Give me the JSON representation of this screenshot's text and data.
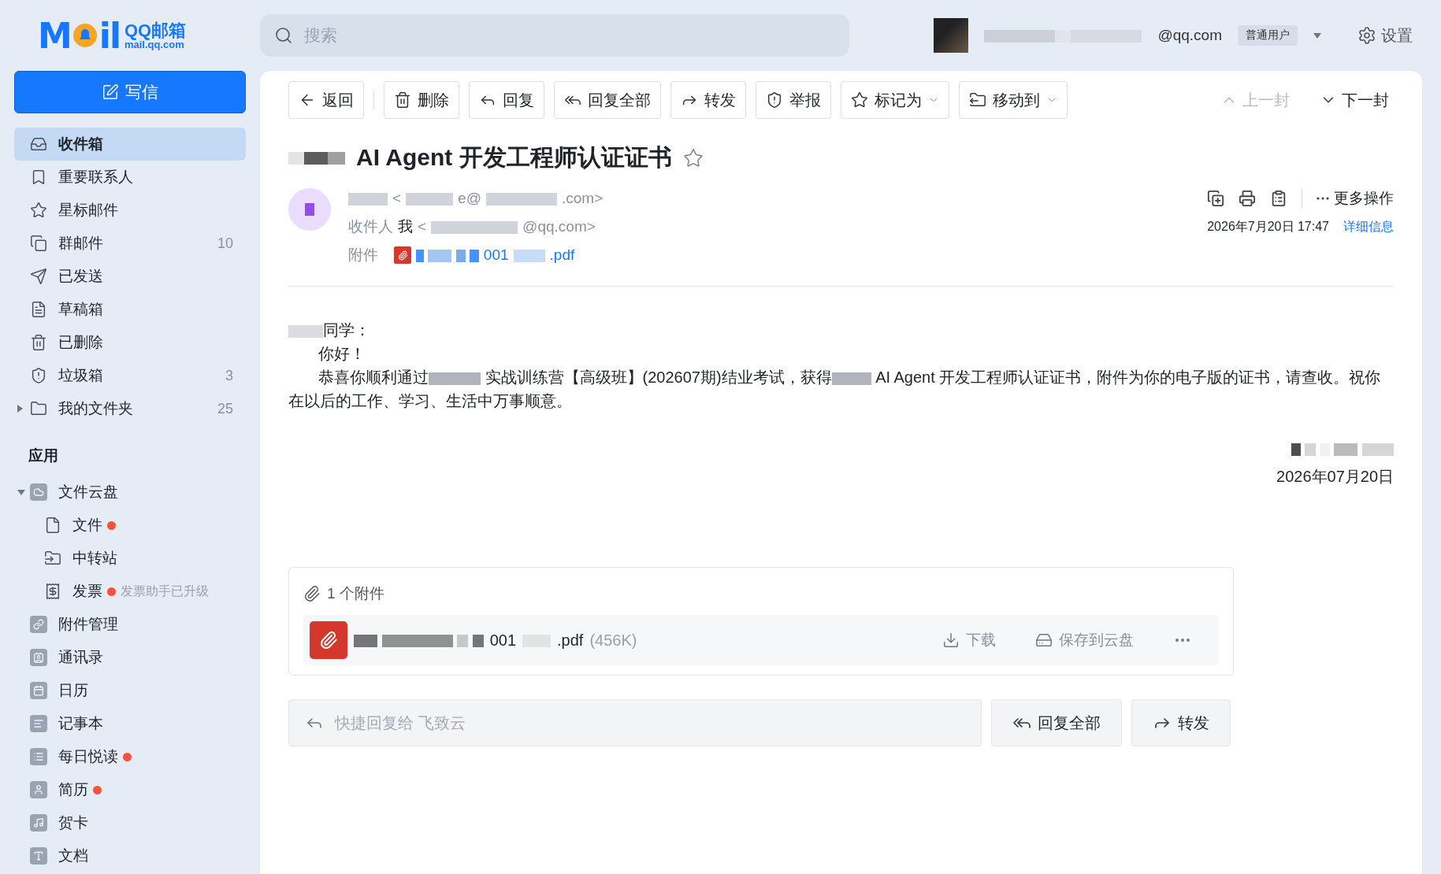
{
  "logo": {
    "mark_left": "M",
    "mark_right": "il",
    "name": "QQ邮箱",
    "domain": "mail.qq.com"
  },
  "search": {
    "placeholder": "搜索"
  },
  "user": {
    "email": "@qq.com",
    "tier": "普通用户"
  },
  "settings": {
    "label": "设置"
  },
  "compose": {
    "label": "写信"
  },
  "folders": [
    {
      "label": "收件箱",
      "selected": true
    },
    {
      "label": "重要联系人",
      "selected": false
    },
    {
      "label": "星标邮件",
      "selected": false
    },
    {
      "label": "群邮件",
      "count": "10",
      "selected": false
    },
    {
      "label": "已发送",
      "selected": false
    },
    {
      "label": "草稿箱",
      "selected": false
    },
    {
      "label": "已删除",
      "selected": false
    },
    {
      "label": "垃圾箱",
      "count": "3",
      "selected": false
    },
    {
      "label": "我的文件夹",
      "count": "25",
      "selected": false,
      "expanded": false
    }
  ],
  "apps_title": "应用",
  "apps": [
    {
      "label": "文件云盘",
      "expanded": true,
      "dot": false,
      "children": [
        {
          "label": "文件",
          "dot": true
        },
        {
          "label": "中转站",
          "dot": false
        },
        {
          "label": "发票",
          "dot": true,
          "note": "发票助手已升级"
        }
      ]
    },
    {
      "label": "附件管理",
      "dot": false
    },
    {
      "label": "通讯录",
      "dot": false
    },
    {
      "label": "日历",
      "dot": false
    },
    {
      "label": "记事本",
      "dot": false
    },
    {
      "label": "每日悦读",
      "dot": true
    },
    {
      "label": "简历",
      "dot": true
    },
    {
      "label": "贺卡",
      "dot": false
    },
    {
      "label": "文档",
      "dot": false
    }
  ],
  "toolbar": [
    {
      "label": "返回",
      "dropdown": false
    },
    {
      "label": "删除",
      "dropdown": false
    },
    {
      "label": "回复",
      "dropdown": false
    },
    {
      "label": "回复全部",
      "dropdown": false
    },
    {
      "label": "转发",
      "dropdown": false
    },
    {
      "label": "举报",
      "dropdown": false
    },
    {
      "label": "标记为",
      "dropdown": true
    },
    {
      "label": "移动到",
      "dropdown": true
    }
  ],
  "nav": [
    {
      "label": "上一封",
      "disabled": true
    },
    {
      "label": "下一封",
      "disabled": false
    }
  ],
  "email": {
    "subject": "AI Agent 开发工程师认证证书",
    "starred": false,
    "sender_parts": [
      "<",
      "e@",
      ".com>"
    ],
    "recipient_label": "收件人",
    "recipient_name": "我",
    "recipient_parts": [
      "<",
      "@qq.com>"
    ],
    "attachment_label": "附件",
    "attachment_parts": [
      "001",
      ".pdf"
    ],
    "more_label": "更多操作",
    "date": "2026年7月20日 17:47",
    "details_link": "详细信息"
  },
  "body": {
    "greeting": "同学：",
    "hello": "你好！",
    "paragraph": [
      {
        "kind": "text",
        "text": "恭喜你顺利通过"
      },
      {
        "kind": "redacted"
      },
      {
        "kind": "text",
        "text": " 实战训练营【高级班】(202607期)结业考试，获得"
      },
      {
        "kind": "redacted"
      },
      {
        "kind": "text",
        "text": " AI Agent 开发工程师认证证书，附件为你的电子版的证书，请查收。祝你在以后的工作、学习、生活中万事顺意。"
      }
    ],
    "signature_date": "2026年07月20日"
  },
  "attachments": {
    "title": "1 个附件",
    "files": [
      {
        "name_parts": [
          "001",
          ".pdf"
        ],
        "size": "(456K)"
      }
    ],
    "download": "下载",
    "save": "保存到云盘"
  },
  "quick_reply": {
    "placeholder": "快捷回复给 飞致云",
    "buttons": [
      {
        "label": "回复全部"
      },
      {
        "label": "转发"
      }
    ]
  }
}
